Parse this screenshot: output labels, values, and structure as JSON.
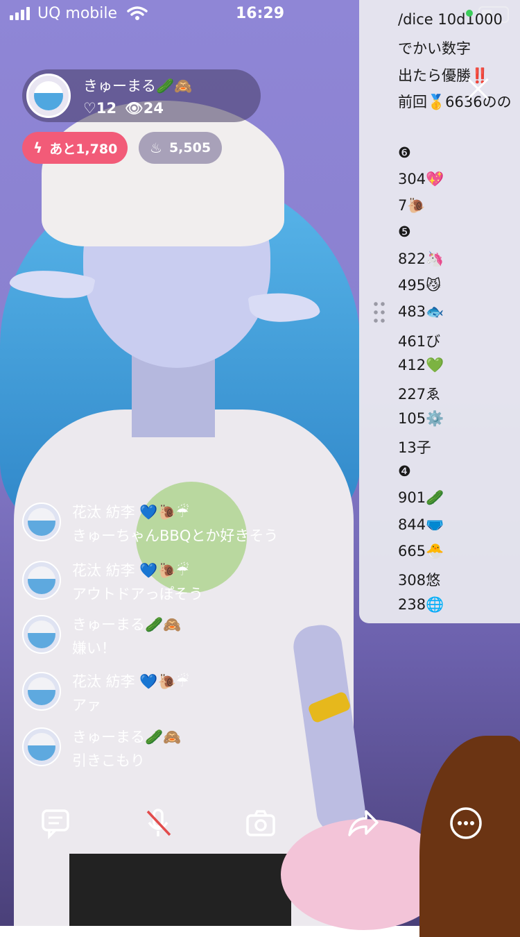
{
  "status_bar": {
    "carrier": "UQ mobile",
    "time": "16:29"
  },
  "host": {
    "name": "きゅーまる🥒🙈",
    "likes": "♡12",
    "viewers": "👁24"
  },
  "pills": {
    "remaining": "あと1,780",
    "fire_count": "5,505"
  },
  "panel": {
    "lines": [
      "/dice 10d1000",
      "でかい数字",
      "出たら優勝‼️",
      "前回🥇6636のの",
      "",
      "❻",
      "304💖",
      "7🐌",
      "❺",
      "822🦄",
      "495😼",
      "483🐟",
      "461び",
      "412💚",
      "227ゑ",
      "105⚙️",
      "13子",
      "❹",
      "901🥒",
      "844🩲",
      "665🐣",
      "308悠",
      "238🌐"
    ]
  },
  "comments": [
    {
      "name": "花汰 紡李 💙🐌☔",
      "text": "きゅーちゃんBBQとか好きそう"
    },
    {
      "name": "花汰 紡李 💙🐌☔",
      "text": "アウトドアっぽそう"
    },
    {
      "name": "きゅーまる🥒🙈",
      "text": "嫌い！"
    },
    {
      "name": "花汰 紡李 💙🐌☔",
      "text": "アァ"
    },
    {
      "name": "きゅーまる🥒🙈",
      "text": "引きこもり"
    }
  ],
  "toolbar": [
    "comment-icon",
    "mic-off-icon",
    "camera-icon",
    "share-icon",
    "more-icon"
  ]
}
